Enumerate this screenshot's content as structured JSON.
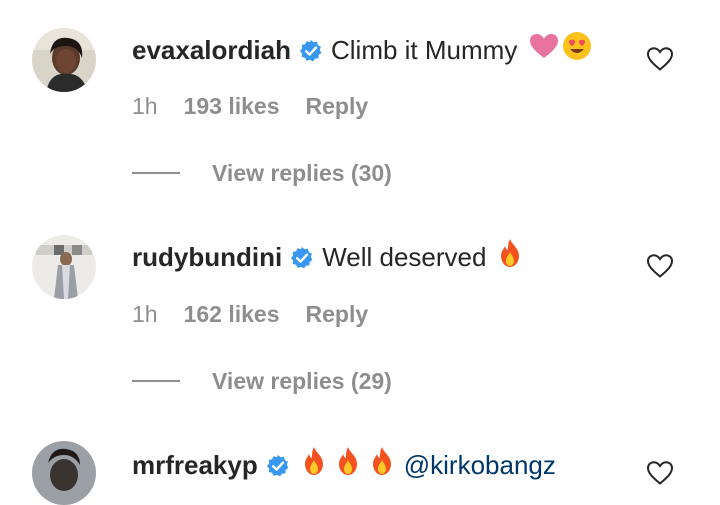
{
  "comments": [
    {
      "username": "evaxalordiah",
      "text": "Climb it Mummy",
      "emojis": [
        "pink-heart",
        "heart-eyes"
      ],
      "time": "1h",
      "likes": "193 likes",
      "reply_label": "Reply",
      "view_replies": "View replies (30)"
    },
    {
      "username": "rudybundini",
      "text": "Well deserved",
      "emojis": [
        "fire"
      ],
      "time": "1h",
      "likes": "162 likes",
      "reply_label": "Reply",
      "view_replies": "View replies (29)"
    },
    {
      "username": "mrfreakyp",
      "text": "",
      "emojis": [
        "fire",
        "fire",
        "fire"
      ],
      "mention": "@kirkobangz"
    }
  ],
  "colors": {
    "text": "#262626",
    "muted": "#8e8e8e",
    "verified": "#3897f0",
    "mention": "#00376b"
  }
}
